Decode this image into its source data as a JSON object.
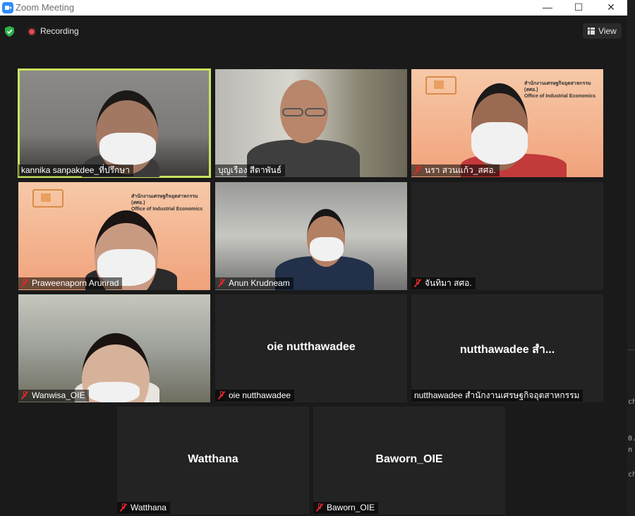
{
  "window": {
    "title": "Zoom Meeting",
    "minimize": "—",
    "maximize": "☐",
    "close": "✕"
  },
  "toolbar": {
    "recording_label": "Recording",
    "view_label": "View"
  },
  "org_text": {
    "thai": "สำนักงานเศรษฐกิจอุตสาหกรรม (สศอ.)",
    "english": "Office of Industrial Economics"
  },
  "participants": [
    {
      "name": "kannika sanpakdee_ที่ปรึกษา",
      "muted": false,
      "video": true,
      "active_speaker": true
    },
    {
      "name": "บุญเรือง สีดาพันธ์",
      "muted": false,
      "video": true,
      "active_speaker": false
    },
    {
      "name": "นรา สวนแก้ว_สศอ.",
      "muted": true,
      "video": true,
      "active_speaker": false
    },
    {
      "name": "Praweenaporn Arunrad",
      "muted": true,
      "video": true,
      "active_speaker": false
    },
    {
      "name": "Anun Krudneam",
      "muted": true,
      "video": true,
      "active_speaker": false
    },
    {
      "name": "จันทิมา สศอ.",
      "muted": true,
      "video": false,
      "active_speaker": false
    },
    {
      "name": "Wanwisa_OIE",
      "muted": true,
      "video": true,
      "active_speaker": false
    },
    {
      "name": "oie nutthawadee",
      "display": "oie nutthawadee",
      "muted": true,
      "video": false,
      "active_speaker": false
    },
    {
      "name": "nutthawadee สำนักงานเศรษฐกิจอุตสาหกรรม",
      "display": "nutthawadee สำ...",
      "muted": false,
      "video": false,
      "active_speaker": false
    },
    {
      "name": "Watthana",
      "display": "Watthana",
      "muted": true,
      "video": false,
      "active_speaker": false
    },
    {
      "name": "Baworn_OIE",
      "display": "Baworn_OIE",
      "muted": true,
      "video": false,
      "active_speaker": false
    }
  ],
  "side_fragments": [
    "ch",
    "0.",
    "n",
    "ch"
  ],
  "colors": {
    "active_speaker_border": "#c8e35f",
    "muted_icon": "#e02828",
    "recording_dot": "#e04b4b",
    "shield": "#2bb24c"
  }
}
